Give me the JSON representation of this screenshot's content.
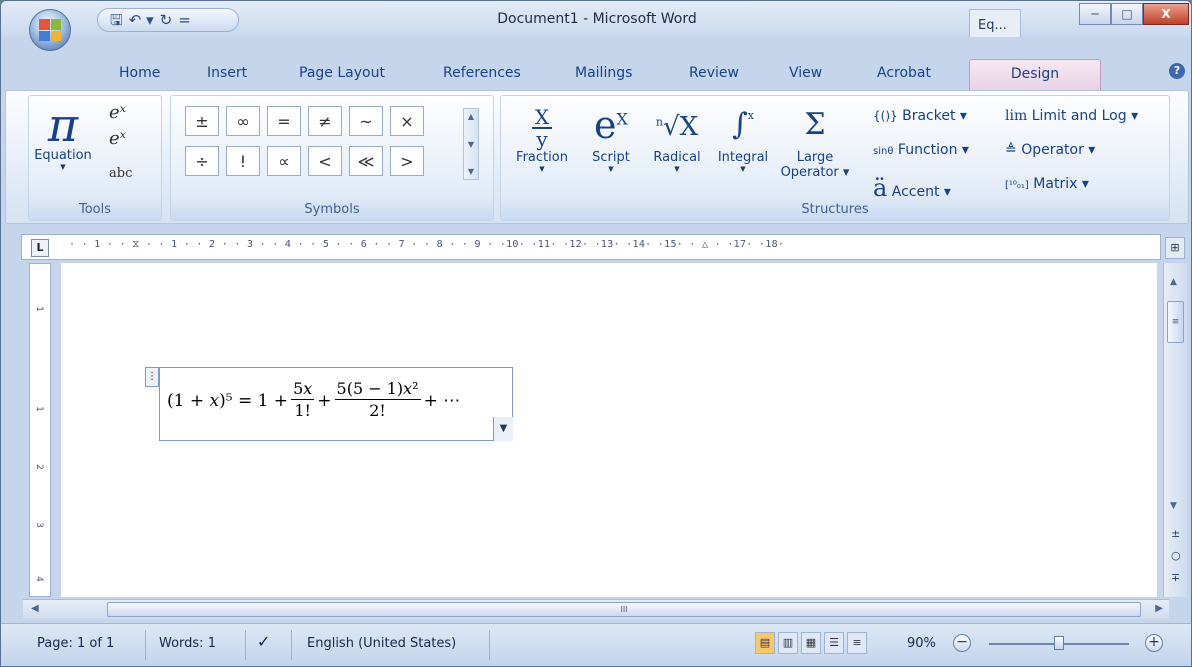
{
  "window": {
    "title": "Document1 - Microsoft Word",
    "extra_tab": "Eq...",
    "min": "─",
    "max": "□",
    "close": "X"
  },
  "qat": {
    "save": "🖫",
    "undo": "↶ ▾",
    "redo": "↻",
    "more": "="
  },
  "tabs": [
    "Home",
    "Insert",
    "Page Layout",
    "References",
    "Mailings",
    "Review",
    "View",
    "Acrobat",
    "Design"
  ],
  "help": "?",
  "ribbon": {
    "tools": {
      "equation_label": "Equation",
      "group_label": "Tools",
      "abc": "abc",
      "pi": "π"
    },
    "symbols": {
      "group_label": "Symbols",
      "items": [
        "±",
        "∞",
        "=",
        "≠",
        "~",
        "×",
        "÷",
        "!",
        "∝",
        "<",
        "≪",
        ">"
      ]
    },
    "structures": {
      "group_label": "Structures",
      "big": [
        {
          "glyph": "x/y",
          "label": "Fraction"
        },
        {
          "glyph": "eˣ",
          "label": "Script"
        },
        {
          "glyph": "ⁿ√x",
          "label": "Radical"
        },
        {
          "glyph": "∫",
          "label": "Integral"
        },
        {
          "glyph": "Σ",
          "label": "Large",
          "label2": "Operator"
        }
      ],
      "small": [
        {
          "icon": "{()}",
          "label": "Bracket"
        },
        {
          "icon": "sinθ",
          "label": "Function"
        },
        {
          "icon": "ä",
          "label": "Accent"
        },
        {
          "icon": "lim",
          "label": "Limit and Log"
        },
        {
          "icon": "≜",
          "label": "Operator"
        },
        {
          "icon": "[¹⁰₀₁]",
          "label": "Matrix"
        }
      ]
    }
  },
  "ruler": {
    "corner": "L",
    "ticks": "· · 1 · · ⧖ · · 1 · · 2 · · 3 · · 4 · · 5 · · 6 · · 7 · · 8 · · 9 · ·10· ·11· ·12· ·13· ·14· ·15· · △ · ·17· ·18·",
    "v": [
      "1",
      "1",
      "2",
      "3",
      "4"
    ]
  },
  "equation": {
    "lhs": "(1 + 𝑥)⁵ = 1 +",
    "f1_num": "5𝑥",
    "f1_den": "1!",
    "plus": "+",
    "f2_num": "5(5 − 1)𝑥²",
    "f2_den": "2!",
    "tail": "+ ⋯"
  },
  "status": {
    "page": "Page: 1 of 1",
    "words": "Words: 1",
    "language": "English (United States)",
    "zoom": "90%",
    "zoom_level": 0.5
  }
}
